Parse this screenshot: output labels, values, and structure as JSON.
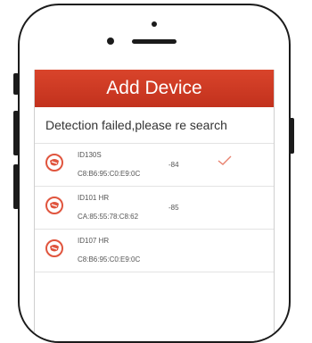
{
  "app": {
    "title": "Add Device"
  },
  "status_message": "Detection failed,please re search",
  "accent_color": "#d13b24",
  "devices": [
    {
      "name": "ID130S",
      "mac": "C8:B6:95:C0:E9:0C",
      "rssi": "-84",
      "selected": true
    },
    {
      "name": "ID101 HR",
      "mac": "CA:85:55:78:C8:62",
      "rssi": "-85",
      "selected": false
    },
    {
      "name": "ID107 HR",
      "mac": "C8:B6:95:C0:E9:0C",
      "rssi": "",
      "selected": false
    }
  ]
}
